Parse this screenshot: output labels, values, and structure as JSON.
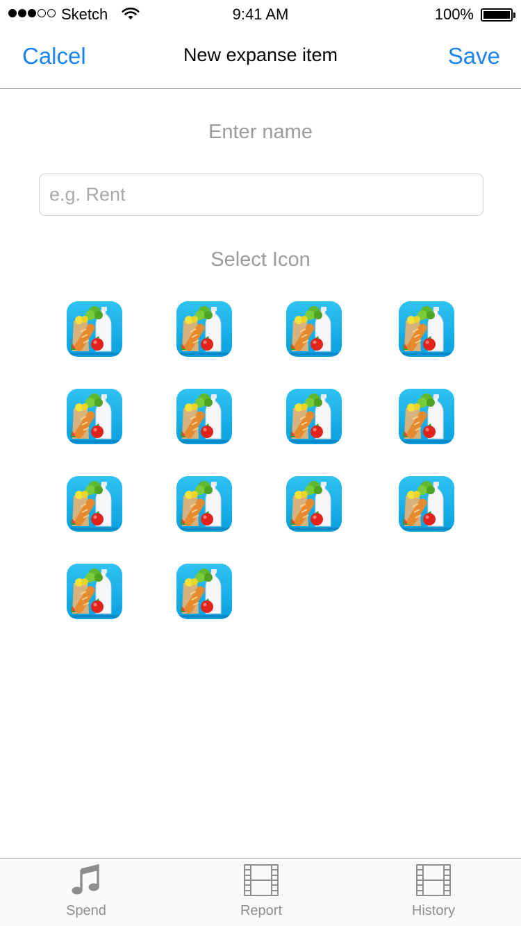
{
  "status_bar": {
    "carrier": "Sketch",
    "time": "9:41 AM",
    "battery": "100%",
    "signal_dots": [
      true,
      true,
      true,
      false,
      false
    ]
  },
  "nav": {
    "left_label": "Calcel",
    "title": "New expanse item",
    "right_label": "Save"
  },
  "form": {
    "name_label": "Enter name",
    "name_placeholder": "e.g. Rent",
    "name_value": "",
    "icon_label": "Select Icon",
    "icons": [
      {
        "icon": "groceries-icon"
      },
      {
        "icon": "groceries-icon"
      },
      {
        "icon": "groceries-icon"
      },
      {
        "icon": "groceries-icon"
      },
      {
        "icon": "groceries-icon"
      },
      {
        "icon": "groceries-icon"
      },
      {
        "icon": "groceries-icon"
      },
      {
        "icon": "groceries-icon"
      },
      {
        "icon": "groceries-icon"
      },
      {
        "icon": "groceries-icon"
      },
      {
        "icon": "groceries-icon"
      },
      {
        "icon": "groceries-icon"
      },
      {
        "icon": "groceries-icon"
      },
      {
        "icon": "groceries-icon"
      }
    ]
  },
  "tabs": [
    {
      "label": "Spend",
      "icon": "music-note-icon"
    },
    {
      "label": "Report",
      "icon": "film-icon"
    },
    {
      "label": "History",
      "icon": "film-icon"
    }
  ],
  "colors": {
    "accent": "#1b82f4",
    "placeholder_text": "#9b9b9b",
    "icon_background": "#14acea",
    "tab_label": "#8e8e8e"
  }
}
